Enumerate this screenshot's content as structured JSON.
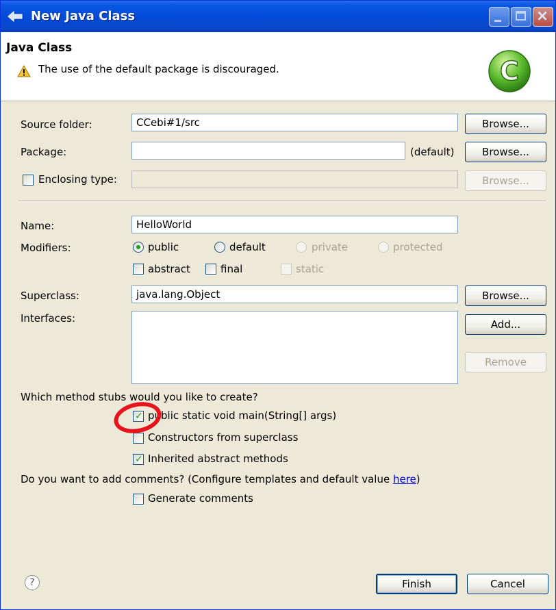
{
  "window": {
    "title": "New Java Class",
    "icon": "eclipse-new-icon",
    "controls": {
      "minimize": "minimize-icon",
      "maximize": "maximize-icon",
      "close": "close-icon"
    }
  },
  "header": {
    "title": "Java Class",
    "message": "The use of the default package is discouraged.",
    "badge_letter": "C"
  },
  "form": {
    "source_folder": {
      "label": "Source folder:",
      "value": "CCebi#1/src",
      "browse": "Browse..."
    },
    "package": {
      "label": "Package:",
      "value": "",
      "suffix": "(default)",
      "browse": "Browse..."
    },
    "enclosing_type": {
      "label": "Enclosing type:",
      "value": "",
      "browse": "Browse...",
      "checked": false
    },
    "name": {
      "label": "Name:",
      "value": "HelloWorld"
    },
    "modifiers": {
      "label": "Modifiers:",
      "radios": [
        "public",
        "default",
        "private",
        "protected"
      ],
      "selected": "public",
      "checkboxes": [
        "abstract",
        "final",
        "static"
      ]
    },
    "superclass": {
      "label": "Superclass:",
      "value": "java.lang.Object",
      "browse": "Browse..."
    },
    "interfaces": {
      "label": "Interfaces:",
      "add": "Add...",
      "remove": "Remove"
    }
  },
  "stubs": {
    "question": "Which method stubs would you like to create?",
    "main": {
      "label": "public static void main(String[] args)",
      "checked": true
    },
    "constructors": {
      "label": "Constructors from superclass",
      "checked": false
    },
    "inherited": {
      "label": "Inherited abstract methods",
      "checked": true
    }
  },
  "comments": {
    "question_prefix": "Do you want to add comments? (Configure templates and default value ",
    "link": "here",
    "question_suffix": ")",
    "generate": {
      "label": "Generate comments",
      "checked": false
    }
  },
  "footer": {
    "help": "?",
    "finish": "Finish",
    "cancel": "Cancel"
  },
  "colors": {
    "titlebar": "#0349d7",
    "dialog_bg": "#ece9d8",
    "check": "#21a121",
    "annotation": "#e8141b"
  }
}
